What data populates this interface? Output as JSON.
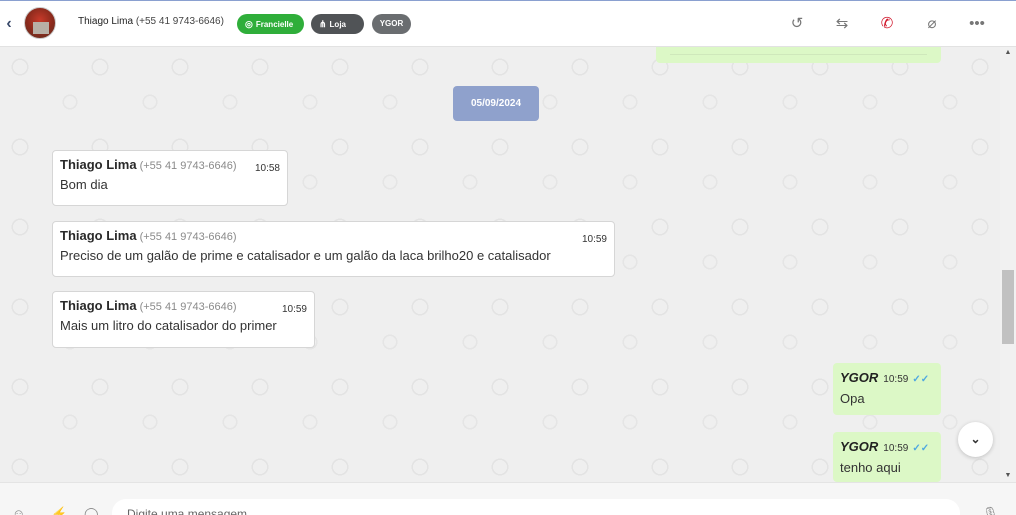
{
  "header": {
    "back_icon": "chevron-left-icon",
    "contact_name": "Thiago Lima",
    "contact_phone": "(+55 41 9743-6646)",
    "tags": [
      {
        "label": "Francielle",
        "icon": "whatsapp-icon",
        "color": "#2fae3a"
      },
      {
        "label": "Loja",
        "icon": "network-icon",
        "color": "#505356"
      },
      {
        "label": "YGOR",
        "color": "#6a6d70"
      }
    ],
    "actions": [
      "history-icon",
      "transfer-icon",
      "hangup-icon",
      "attachment-icon",
      "more-icon"
    ]
  },
  "chat": {
    "date_divider": "05/09/2024",
    "incoming": [
      {
        "sender": "Thiago Lima",
        "phone": "(+55 41 9743-6646)",
        "time": "10:58",
        "text": "Bom dia"
      },
      {
        "sender": "Thiago Lima",
        "phone": "(+55 41 9743-6646)",
        "time": "10:59",
        "text": "Preciso de um galão de prime e catalisador e um galão da laca brilho20 e catalisador"
      },
      {
        "sender": "Thiago Lima",
        "phone": "(+55 41 9743-6646)",
        "time": "10:59",
        "text": "Mais um litro do catalisador do primer"
      }
    ],
    "outgoing": [
      {
        "sender": "YGOR",
        "time": "10:59",
        "status": "read",
        "text": "Opa"
      },
      {
        "sender": "YGOR",
        "time": "10:59",
        "status": "read",
        "text": "tenho aqui"
      }
    ],
    "colors": {
      "incoming_bg": "#ffffff",
      "outgoing_bg": "#dcf8c6",
      "date_pill": "#8fa1cc",
      "read_ticks": "#4fa8e0"
    }
  },
  "composer": {
    "placeholder": "Digite uma mensagem",
    "icons": [
      "emoji-icon",
      "quick-reply-icon",
      "sticker-icon",
      "microphone-icon"
    ]
  }
}
